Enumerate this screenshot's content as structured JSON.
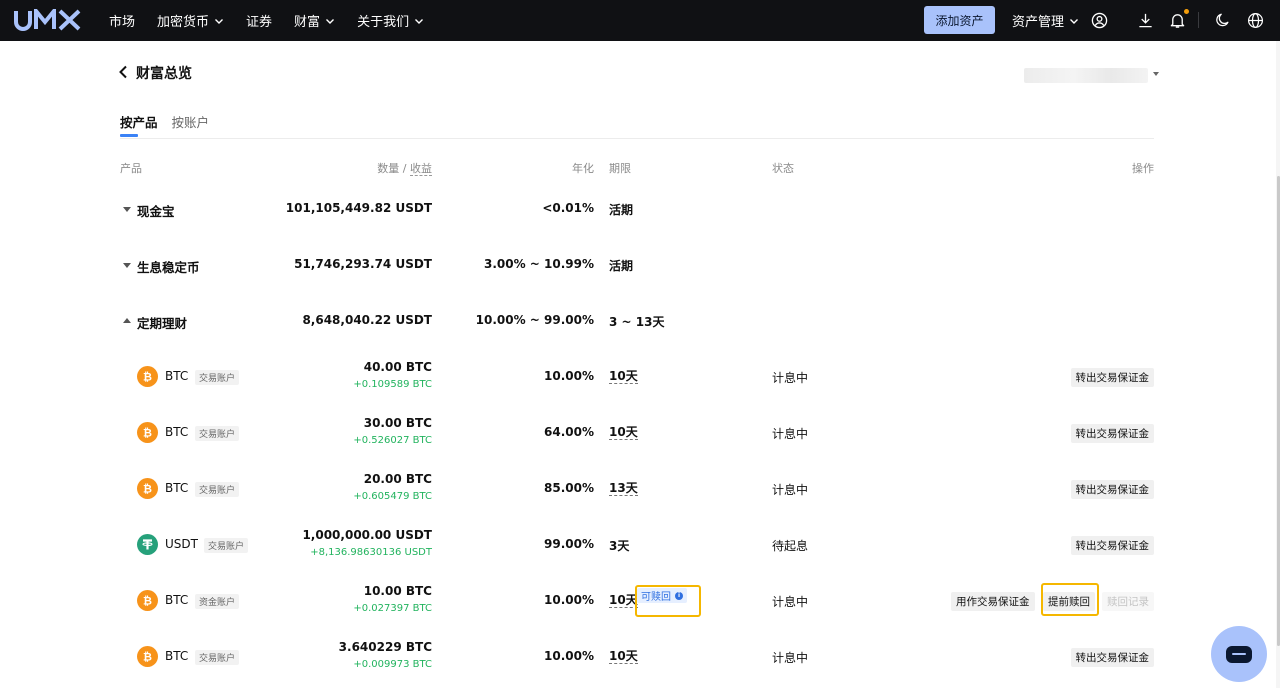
{
  "nav": {
    "logo": "UMX",
    "menu": [
      {
        "label": "市场",
        "has_dropdown": false
      },
      {
        "label": "加密货币",
        "has_dropdown": true
      },
      {
        "label": "证券",
        "has_dropdown": false
      },
      {
        "label": "财富",
        "has_dropdown": true
      },
      {
        "label": "关于我们",
        "has_dropdown": true
      }
    ],
    "add_asset": "添加资产",
    "asset_mgmt": "资产管理",
    "icons": [
      "user-icon",
      "download-icon",
      "bell-icon",
      "moon-icon",
      "globe-icon"
    ]
  },
  "header": {
    "title": "财富总览",
    "back_icon": "chevron-left-icon"
  },
  "tabs": [
    {
      "label": "按产品",
      "active": true
    },
    {
      "label": "按账户",
      "active": false
    }
  ],
  "table": {
    "columns": {
      "product": "产品",
      "amount": "数量",
      "amount_sep": "/",
      "income": "收益",
      "apr": "年化",
      "term": "期限",
      "status": "状态",
      "action": "操作"
    },
    "groups": [
      {
        "name": "现金宝",
        "expanded": false,
        "amount": "101,105,449.82 USDT",
        "apr": "<0.01%",
        "term": "活期"
      },
      {
        "name": "生息稳定币",
        "expanded": false,
        "amount": "51,746,293.74 USDT",
        "apr": "3.00% ~ 10.99%",
        "term": "活期"
      },
      {
        "name": "定期理财",
        "expanded": true,
        "amount": "8,648,040.22 USDT",
        "apr": "10.00% ~ 99.00%",
        "term": "3 ~ 13天"
      }
    ],
    "items": [
      {
        "coin": "BTC",
        "coin_icon": "btc-icon",
        "account": "交易账户",
        "amount": "40.00 BTC",
        "income": "+0.109589 BTC",
        "apr": "10.00%",
        "term": "10天",
        "status": "计息中",
        "actions": [
          "转出交易保证金"
        ]
      },
      {
        "coin": "BTC",
        "coin_icon": "btc-icon",
        "account": "交易账户",
        "amount": "30.00 BTC",
        "income": "+0.526027 BTC",
        "apr": "64.00%",
        "term": "10天",
        "status": "计息中",
        "actions": [
          "转出交易保证金"
        ]
      },
      {
        "coin": "BTC",
        "coin_icon": "btc-icon",
        "account": "交易账户",
        "amount": "20.00 BTC",
        "income": "+0.605479 BTC",
        "apr": "85.00%",
        "term": "13天",
        "status": "计息中",
        "actions": [
          "转出交易保证金"
        ]
      },
      {
        "coin": "USDT",
        "coin_icon": "usdt-icon",
        "account": "交易账户",
        "amount": "1,000,000.00 USDT",
        "income": "+8,136.98630136 USDT",
        "apr": "99.00%",
        "term": "3天",
        "status": "待起息",
        "actions": [
          "转出交易保证金"
        ]
      },
      {
        "coin": "BTC",
        "coin_icon": "btc-icon",
        "account": "资金账户",
        "amount": "10.00 BTC",
        "income": "+0.027397 BTC",
        "apr": "10.00%",
        "term": "10天",
        "badge": "可赎回",
        "status": "计息中",
        "actions": [
          "用作交易保证金",
          "提前赎回",
          "赎回记录"
        ]
      },
      {
        "coin": "BTC",
        "coin_icon": "btc-icon",
        "account": "交易账户",
        "amount": "3.640229 BTC",
        "income": "+0.009973 BTC",
        "apr": "10.00%",
        "term": "10天",
        "status": "计息中",
        "actions": [
          "转出交易保证金"
        ]
      }
    ]
  },
  "colors": {
    "nav_bg": "#101114",
    "accent": "#a9c2fb",
    "positive": "#22b35e",
    "btc": "#f7931a",
    "usdt": "#26a17b",
    "highlight": "#f5b700"
  }
}
